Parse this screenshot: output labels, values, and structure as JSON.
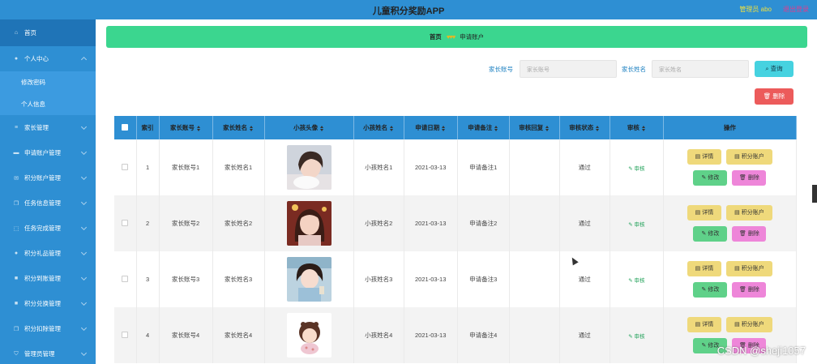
{
  "app": {
    "title": "儿童积分奖励APP",
    "admin": "管理员 abo",
    "logout": "退出登录"
  },
  "sidebar": {
    "items": [
      {
        "label": "首页",
        "icon": "home-icon"
      },
      {
        "label": "个人中心",
        "icon": "user-icon"
      },
      {
        "label": "修改密码",
        "icon": ""
      },
      {
        "label": "个人信息",
        "icon": ""
      },
      {
        "label": "家长管理",
        "icon": "list-icon"
      },
      {
        "label": "申请账户管理",
        "icon": "card-icon"
      },
      {
        "label": "积分账户管理",
        "icon": "mail-icon"
      },
      {
        "label": "任务信息管理",
        "icon": "copy-icon"
      },
      {
        "label": "任务完成管理",
        "icon": "frame-icon"
      },
      {
        "label": "积分礼品管理",
        "icon": "user-icon"
      },
      {
        "label": "积分到账管理",
        "icon": "box-icon"
      },
      {
        "label": "积分兑换管理",
        "icon": "box-icon"
      },
      {
        "label": "积分扣除管理",
        "icon": "copy-icon"
      },
      {
        "label": "管理员管理",
        "icon": "shield-icon"
      }
    ]
  },
  "breadcrumb": {
    "home": "首页",
    "sep": "♥♥♥",
    "current": "申请账户"
  },
  "search": {
    "account_label": "家长账号",
    "account_placeholder": "家长账号",
    "name_label": "家长姓名",
    "name_placeholder": "家长姓名",
    "query_btn": "查询",
    "delete_btn": "删除"
  },
  "table": {
    "headers": [
      "索引",
      "家长账号",
      "家长姓名",
      "小孩头像",
      "小孩姓名",
      "申请日期",
      "申请备注",
      "审核回复",
      "审核状态",
      "审核",
      "操作"
    ],
    "rows": [
      {
        "index": "1",
        "account": "家长账号1",
        "name": "家长姓名1",
        "child": "小孩姓名1",
        "date": "2021-03-13",
        "note": "申请备注1",
        "reply": "",
        "status": "通过",
        "audit": "审核"
      },
      {
        "index": "2",
        "account": "家长账号2",
        "name": "家长姓名2",
        "child": "小孩姓名2",
        "date": "2021-03-13",
        "note": "申请备注2",
        "reply": "",
        "status": "通过",
        "audit": "审核"
      },
      {
        "index": "3",
        "account": "家长账号3",
        "name": "家长姓名3",
        "child": "小孩姓名3",
        "date": "2021-03-13",
        "note": "申请备注3",
        "reply": "",
        "status": "通过",
        "audit": "审核"
      },
      {
        "index": "4",
        "account": "家长账号4",
        "name": "家长姓名4",
        "child": "小孩姓名4",
        "date": "2021-03-13",
        "note": "申请备注4",
        "reply": "",
        "status": "通过",
        "audit": "审核"
      }
    ],
    "ops": {
      "detail": "详情",
      "points": "积分账户",
      "edit": "修改",
      "remove": "删除"
    }
  },
  "watermark": "CSDN @sheji1057"
}
